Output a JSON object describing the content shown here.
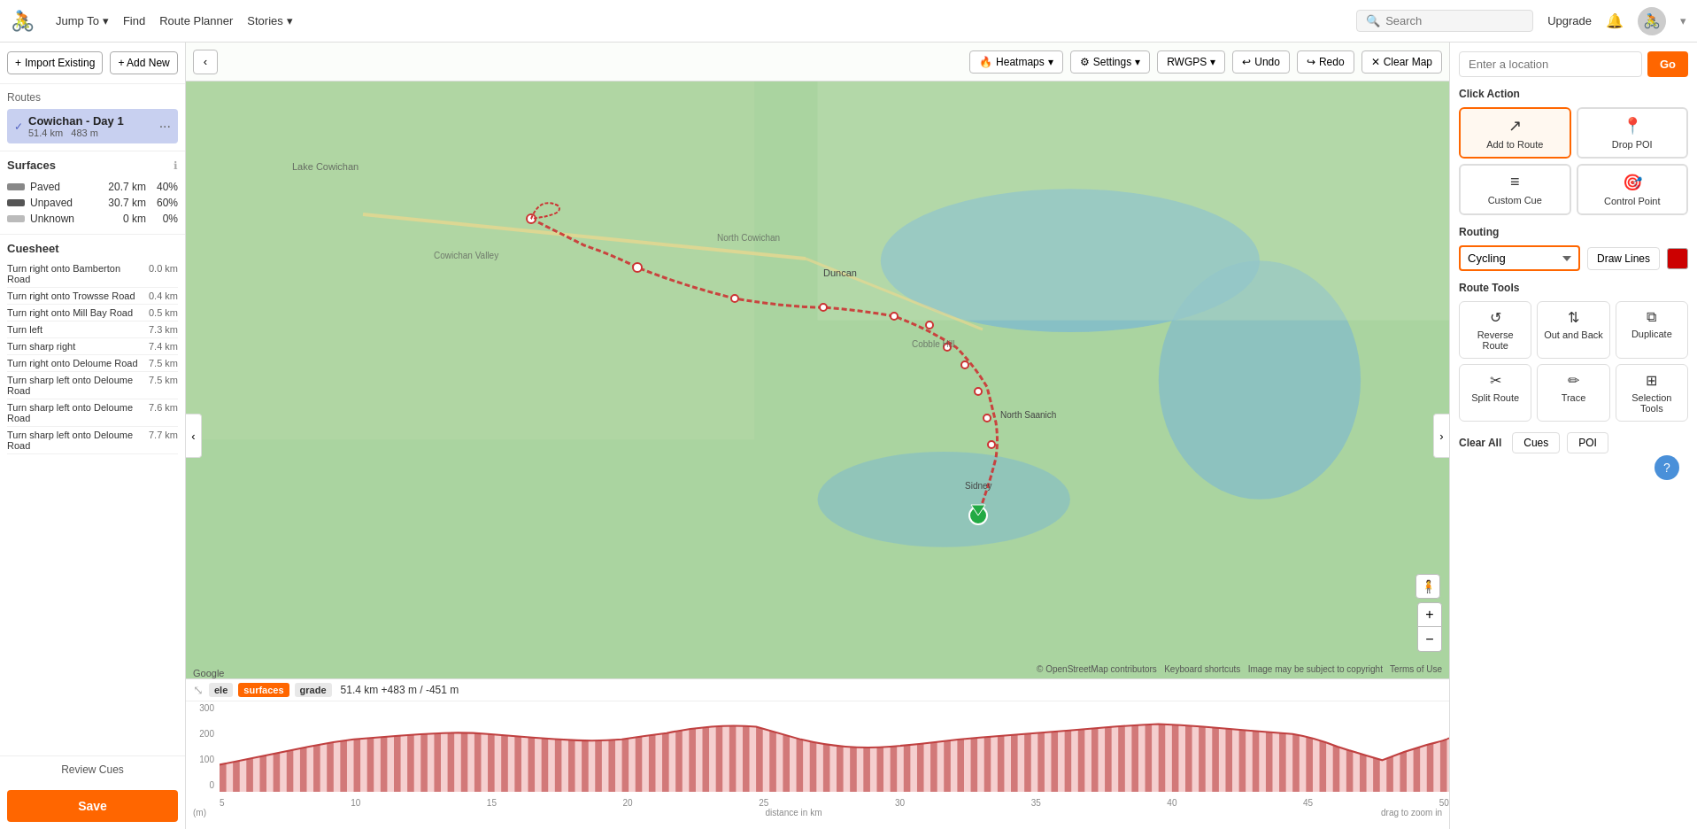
{
  "nav": {
    "logo_symbol": "⊙",
    "jump_to": "Jump To",
    "find": "Find",
    "route_planner": "Route Planner",
    "stories": "Stories",
    "search_placeholder": "Search",
    "upgrade": "Upgrade"
  },
  "sidebar": {
    "import_label": "Import Existing",
    "add_new_label": "+ Add New",
    "routes_label": "Routes",
    "route_name": "Cowichan - Day 1",
    "route_km": "51.4 km",
    "route_elevation": "483 m",
    "surfaces_title": "Surfaces",
    "surfaces": [
      {
        "name": "Paved",
        "km": "20.7 km",
        "pct": "40%"
      },
      {
        "name": "Unpaved",
        "km": "30.7 km",
        "pct": "60%"
      },
      {
        "name": "Unknown",
        "km": "0 km",
        "pct": "0%"
      }
    ],
    "cuesheet_title": "Cuesheet",
    "cues": [
      {
        "text": "Turn right onto Bamberton Road",
        "km": "0.0 km"
      },
      {
        "text": "Turn right onto Trowsse Road",
        "km": "0.4 km"
      },
      {
        "text": "Turn right onto Mill Bay Road",
        "km": "0.5 km"
      },
      {
        "text": "Turn left",
        "km": "7.3 km"
      },
      {
        "text": "Turn sharp right",
        "km": "7.4 km"
      },
      {
        "text": "Turn right onto Deloume Road",
        "km": "7.5 km"
      },
      {
        "text": "Turn sharp left onto Deloume Road",
        "km": "7.5 km"
      },
      {
        "text": "Turn sharp left onto Deloume Road",
        "km": "7.6 km"
      },
      {
        "text": "Turn sharp left onto Deloume Road",
        "km": "7.7 km"
      }
    ],
    "review_cues_label": "Review Cues",
    "save_label": "Save"
  },
  "map_toolbar": {
    "undo_label": "Undo",
    "redo_label": "Redo",
    "clear_map_label": "Clear Map",
    "heatmaps_label": "Heatmaps",
    "settings_label": "Settings",
    "rwgps_label": "RWGPS"
  },
  "right_panel": {
    "location_placeholder": "Enter a location",
    "go_label": "Go",
    "click_action_label": "Click Action",
    "actions": [
      {
        "id": "add-to-route",
        "label": "Add to Route",
        "icon": "↗",
        "active": true
      },
      {
        "id": "drop-poi",
        "label": "Drop POI",
        "icon": "📍",
        "active": false
      },
      {
        "id": "custom-cue",
        "label": "Custom Cue",
        "icon": "≡",
        "active": false
      },
      {
        "id": "control-point",
        "label": "Control Point",
        "icon": "🎯",
        "active": false
      }
    ],
    "routing_label": "Routing",
    "routing_option": "Cycling",
    "draw_lines_label": "Draw Lines",
    "route_tools_label": "Route Tools",
    "tools": [
      {
        "id": "reverse-route",
        "label": "Reverse Route",
        "icon": "↺"
      },
      {
        "id": "out-and-back",
        "label": "Out and Back",
        "icon": "⇅"
      },
      {
        "id": "duplicate",
        "label": "Duplicate",
        "icon": "⧉"
      },
      {
        "id": "split-route",
        "label": "Split Route",
        "icon": "✂"
      },
      {
        "id": "trace",
        "label": "Trace",
        "icon": "✏"
      },
      {
        "id": "selection-tools",
        "label": "Selection Tools",
        "icon": "⊞"
      }
    ],
    "clear_all_label": "Clear All",
    "cues_label": "Cues",
    "poi_label": "POI"
  },
  "elevation": {
    "ele_label": "ele",
    "surfaces_label": "surfaces",
    "grade_label": "grade",
    "stats": "51.4 km +483 m / -451 m",
    "y_ticks": [
      "300",
      "200",
      "100",
      "0"
    ],
    "x_ticks": [
      "5",
      "10",
      "15",
      "20",
      "25",
      "30",
      "35",
      "40",
      "45",
      "50"
    ],
    "y_unit": "(m)",
    "x_unit": "distance in km",
    "drag_label": "drag to zoom in"
  }
}
